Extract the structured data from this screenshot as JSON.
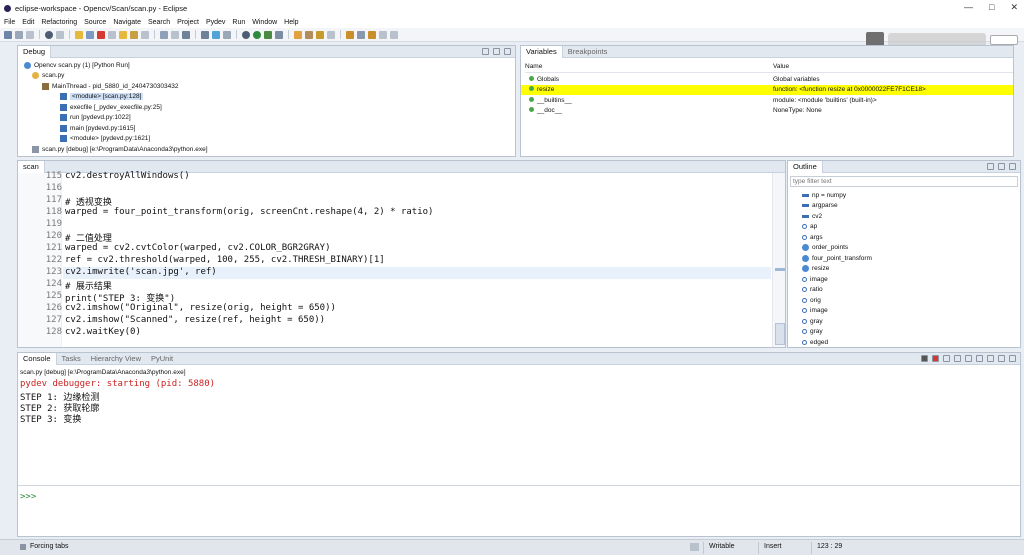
{
  "window": {
    "title": "eclipse-workspace - Opencv/Scan/scan.py - Eclipse"
  },
  "menu": [
    "File",
    "Edit",
    "Refactoring",
    "Source",
    "Navigate",
    "Search",
    "Project",
    "Pydev",
    "Run",
    "Window",
    "Help"
  ],
  "debug": {
    "tab": "Debug",
    "tree": [
      "Opencv scan.py (1) [Python Run]",
      "scan.py",
      "MainThread - pid_5880_id_2404730303432",
      "<module> [scan.py:128]",
      "execfile [_pydev_execfile.py:25]",
      "run [pydevd.py:1022]",
      "main [pydevd.py:1615]",
      "<module> [pydevd.py:1621]",
      "scan.py [debug] [e:\\ProgramData\\Anaconda3\\python.exe]"
    ]
  },
  "variables": {
    "tab": "Variables",
    "tab2": "Breakpoints",
    "col_name": "Name",
    "col_value": "Value",
    "rows": [
      {
        "name": "Globals",
        "value": "Global variables"
      },
      {
        "name": "resize",
        "value": "function: <function resize at 0x0000022FE7F1CE18>"
      },
      {
        "name": "__builtins__",
        "value": "module: <module 'builtins' (built-in)>"
      },
      {
        "name": "__doc__",
        "value": "NoneType: None"
      }
    ]
  },
  "editor": {
    "tab": "scan",
    "lines": [
      {
        "n": "115",
        "code": "cv2.destroyAllWindows()"
      },
      {
        "n": "116",
        "code": ""
      },
      {
        "n": "117",
        "code": "# 透视变换"
      },
      {
        "n": "118",
        "code": "warped = four_point_transform(orig, screenCnt.reshape(4, 2) * ratio)"
      },
      {
        "n": "119",
        "code": ""
      },
      {
        "n": "120",
        "code": "# 二值处理"
      },
      {
        "n": "121",
        "code": "warped = cv2.cvtColor(warped, cv2.COLOR_BGR2GRAY)"
      },
      {
        "n": "122",
        "code": "ref = cv2.threshold(warped, 100, 255, cv2.THRESH_BINARY)[1]"
      },
      {
        "n": "123",
        "code": "cv2.imwrite('scan.jpg', ref)"
      },
      {
        "n": "124",
        "code": "# 展示结果"
      },
      {
        "n": "125",
        "code": "print(\"STEP 3: 变换\")"
      },
      {
        "n": "126",
        "code": "cv2.imshow(\"Original\", resize(orig, height = 650))"
      },
      {
        "n": "127",
        "code": "cv2.imshow(\"Scanned\", resize(ref, height = 650))"
      },
      {
        "n": "128",
        "code": "cv2.waitKey(0)"
      }
    ]
  },
  "outline": {
    "tab": "Outline",
    "filter_placeholder": "type filter text",
    "items": [
      "np = numpy",
      "argparse",
      "cv2",
      "ap",
      "args",
      "order_points",
      "four_point_transform",
      "resize",
      "image",
      "ratio",
      "orig",
      "image",
      "gray",
      "gray",
      "edged"
    ]
  },
  "console": {
    "tabs": [
      "Console",
      "Tasks",
      "Hierarchy View",
      "PyUnit"
    ],
    "header": "scan.py [debug] [e:\\ProgramData\\Anaconda3\\python.exe]",
    "lines": [
      "pydev debugger: starting (pid: 5880)",
      "STEP 1: 边缘检测",
      "STEP 2: 获取轮廓",
      "STEP 3: 变换"
    ],
    "prompt": ">>>"
  },
  "status": {
    "left": "Forcing tabs",
    "mode": "Writable",
    "insert": "Insert",
    "pos": "123 : 29"
  },
  "colors": {
    "highlight": "#ffff00",
    "accent": "#cfe0f7"
  }
}
